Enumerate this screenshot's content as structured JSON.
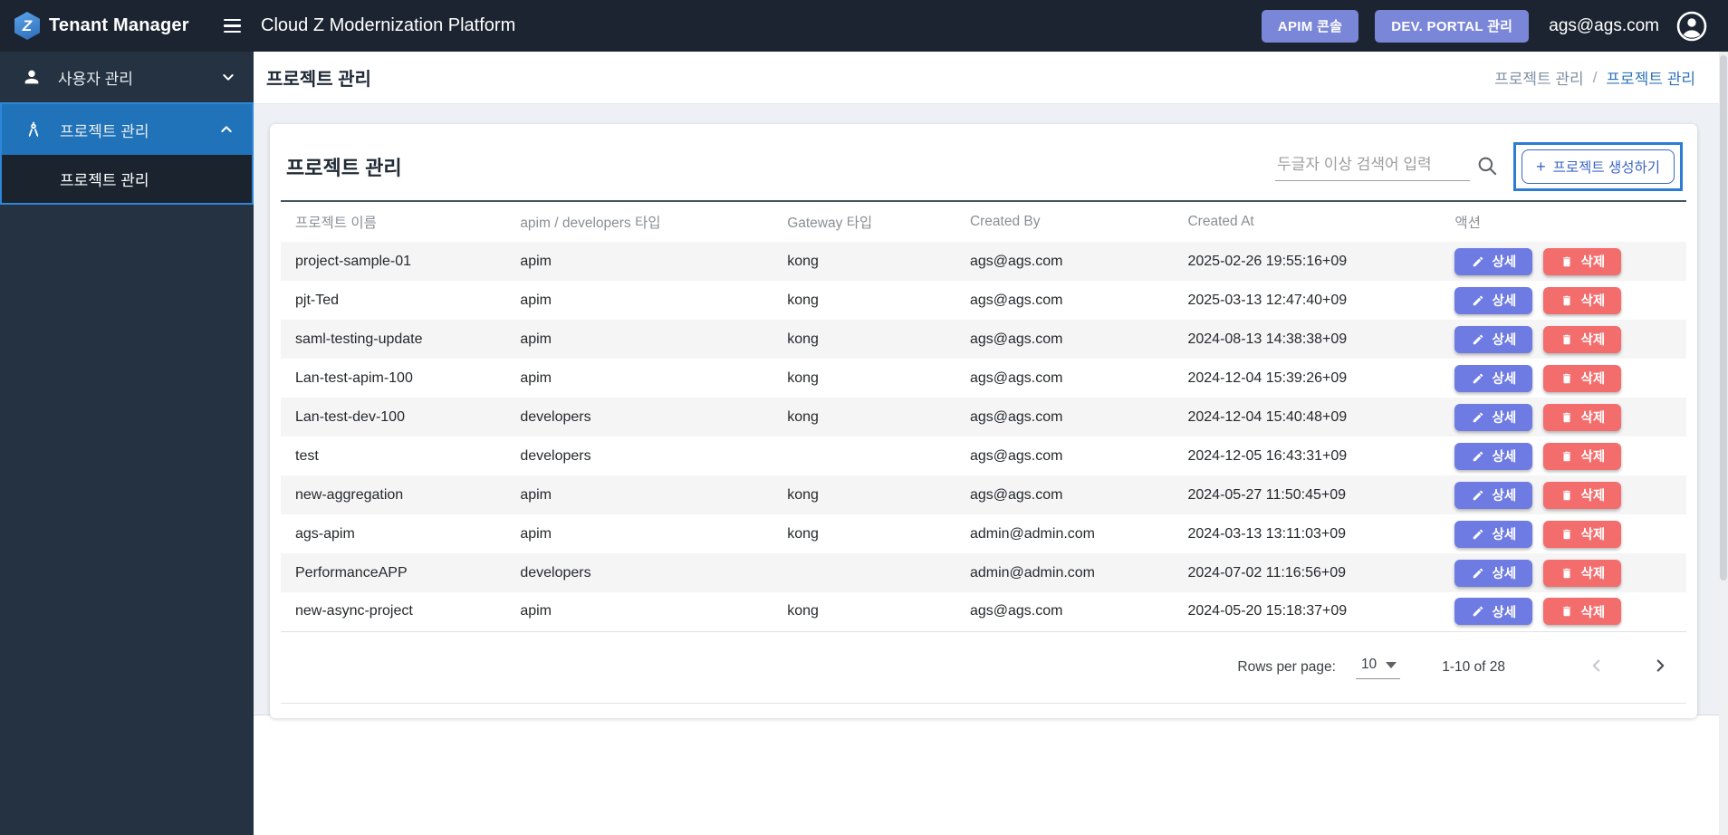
{
  "topbar": {
    "logo_letter": "Z",
    "logo_text": "Tenant Manager",
    "app_title": "Cloud Z Modernization Platform",
    "apim_button": "APIM 콘솔",
    "portal_button": "DEV. PORTAL 관리",
    "user_email": "ags@ags.com"
  },
  "sidebar": {
    "user_label": "사용자 관리",
    "project_label": "프로젝트 관리",
    "project_child_label": "프로젝트 관리"
  },
  "page": {
    "title": "프로젝트 관리",
    "breadcrumb": {
      "parent": "프로젝트 관리",
      "separator": "/",
      "current": "프로젝트 관리"
    }
  },
  "card": {
    "title": "프로젝트 관리",
    "search_placeholder": "두글자 이상 검색어 입력",
    "create_plus": "+",
    "create_label": "프로젝트 생성하기"
  },
  "table": {
    "columns": [
      "프로젝트 이름",
      "apim / developers 타입",
      "Gateway 타입",
      "Created By",
      "Created At",
      "액션"
    ],
    "action_labels": {
      "detail": "상세",
      "del": "삭제"
    },
    "rows": [
      {
        "name": "project-sample-01",
        "type": "apim",
        "gateway": "kong",
        "created_by": "ags@ags.com",
        "created_at": "2025-02-26 19:55:16+09"
      },
      {
        "name": "pjt-Ted",
        "type": "apim",
        "gateway": "kong",
        "created_by": "ags@ags.com",
        "created_at": "2025-03-13 12:47:40+09"
      },
      {
        "name": "saml-testing-update",
        "type": "apim",
        "gateway": "kong",
        "created_by": "ags@ags.com",
        "created_at": "2024-08-13 14:38:38+09"
      },
      {
        "name": "Lan-test-apim-100",
        "type": "apim",
        "gateway": "kong",
        "created_by": "ags@ags.com",
        "created_at": "2024-12-04 15:39:26+09"
      },
      {
        "name": "Lan-test-dev-100",
        "type": "developers",
        "gateway": "kong",
        "created_by": "ags@ags.com",
        "created_at": "2024-12-04 15:40:48+09"
      },
      {
        "name": "test",
        "type": "developers",
        "gateway": "",
        "created_by": "ags@ags.com",
        "created_at": "2024-12-05 16:43:31+09"
      },
      {
        "name": "new-aggregation",
        "type": "apim",
        "gateway": "kong",
        "created_by": "ags@ags.com",
        "created_at": "2024-05-27 11:50:45+09"
      },
      {
        "name": "ags-apim",
        "type": "apim",
        "gateway": "kong",
        "created_by": "admin@admin.com",
        "created_at": "2024-03-13 13:11:03+09"
      },
      {
        "name": "PerformanceAPP",
        "type": "developers",
        "gateway": "",
        "created_by": "admin@admin.com",
        "created_at": "2024-07-02 11:16:56+09"
      },
      {
        "name": "new-async-project",
        "type": "apim",
        "gateway": "kong",
        "created_by": "ags@ags.com",
        "created_at": "2024-05-20 15:18:37+09"
      }
    ]
  },
  "pagination": {
    "rows_per_page_label": "Rows per page:",
    "rows_per_page_value": "10",
    "range_label": "1-10 of 28"
  },
  "colors": {
    "topbar_bg": "#1b2430",
    "sidebar_bg": "#243241",
    "sidebar_active_bg": "#2173b9",
    "sidebar_outline": "#2e86d8",
    "topbar_button_bg": "#7a86d8",
    "detail_button_bg": "#6e7be2",
    "delete_button_bg": "#f36d6d",
    "create_button_blue": "#3b66c4",
    "create_ring_blue": "#2a7dd2",
    "breadcrumb_link": "#2f74b8",
    "row_stripe": "#f5f5f6",
    "content_bg": "#edf0f4"
  }
}
